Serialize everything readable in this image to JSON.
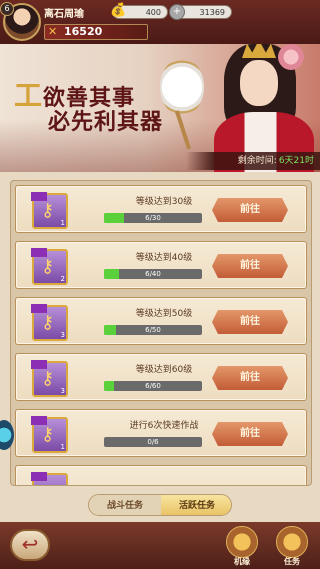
{
  "player": {
    "level": "6",
    "name": "离石周瑜",
    "power": "16520"
  },
  "resources": {
    "gold": "400",
    "coins": "31369"
  },
  "banner": {
    "title_cap": "工",
    "title_rest": "欲善其事",
    "subtitle": "必先利其器",
    "remaining_label": "剩余时间:",
    "remaining_value": "6天21时"
  },
  "tasks": [
    {
      "desc": "等级达到30级",
      "current": 6,
      "target": 30,
      "progress_text": "6/30",
      "reward_qty": "1",
      "action": "前往"
    },
    {
      "desc": "等级达到40级",
      "current": 6,
      "target": 40,
      "progress_text": "6/40",
      "reward_qty": "2",
      "action": "前往"
    },
    {
      "desc": "等级达到50级",
      "current": 6,
      "target": 50,
      "progress_text": "6/50",
      "reward_qty": "3",
      "action": "前往"
    },
    {
      "desc": "等级达到60级",
      "current": 6,
      "target": 60,
      "progress_text": "6/60",
      "reward_qty": "3",
      "action": "前往"
    },
    {
      "desc": "进行6次快速作战",
      "current": 0,
      "target": 6,
      "progress_text": "0/6",
      "reward_qty": "1",
      "action": "前往"
    }
  ],
  "tabs": {
    "battle": "战斗任务",
    "active": "活跃任务"
  },
  "nav": {
    "fate": "机缘",
    "task": "任务"
  },
  "icons": {
    "back": "back-arrow-icon",
    "reward": "key-icon",
    "power": "crossed-swords-icon"
  }
}
